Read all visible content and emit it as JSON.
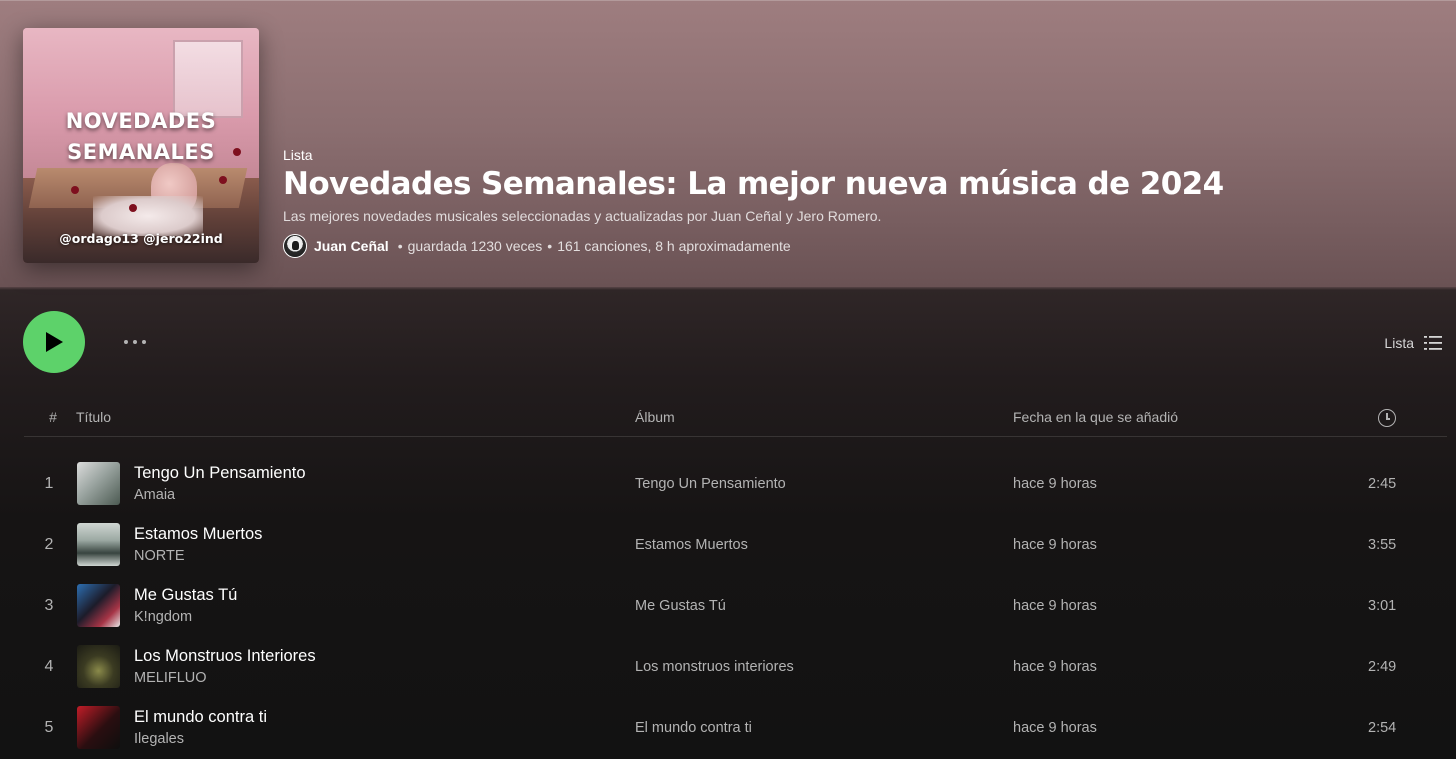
{
  "playlist": {
    "kind": "Lista",
    "title": "Novedades Semanales: La mejor nueva música de 2024",
    "description": "Las mejores novedades musicales seleccionadas y actualizadas por Juan Ceñal y Jero Romero.",
    "owner": "Juan Ceñal",
    "saves": "guardada 1230 veces",
    "stats": "161 canciones, 8 h aproximadamente",
    "separator": "•",
    "cover": {
      "line1": "NOVEDADES",
      "line2": "SEMANALES",
      "handles": "@ordago13 @jero22ind"
    }
  },
  "actions": {
    "play_icon": "play-icon",
    "more_icon": "more-icon",
    "view_label": "Lista",
    "view_icon": "list-icon"
  },
  "table": {
    "headers": {
      "number": "#",
      "title": "Título",
      "album": "Álbum",
      "date_added": "Fecha en la que se añadió",
      "duration_icon": "clock-icon"
    },
    "rows": [
      {
        "number": "1",
        "title": "Tengo Un Pensamiento",
        "artist": "Amaia",
        "album": "Tengo Un Pensamiento",
        "added": "hace 9 horas",
        "duration": "2:45"
      },
      {
        "number": "2",
        "title": "Estamos Muertos",
        "artist": "NORTE",
        "album": "Estamos Muertos",
        "added": "hace 9 horas",
        "duration": "3:55"
      },
      {
        "number": "3",
        "title": "Me Gustas Tú",
        "artist": "K!ngdom",
        "album": "Me Gustas Tú",
        "added": "hace 9 horas",
        "duration": "3:01"
      },
      {
        "number": "4",
        "title": "Los Monstruos Interiores",
        "artist": "MELIFLUO",
        "album": "Los monstruos interiores",
        "added": "hace 9 horas",
        "duration": "2:49"
      },
      {
        "number": "5",
        "title": "El mundo contra ti",
        "artist": "Ilegales",
        "album": "El mundo contra ti",
        "added": "hace 9 horas",
        "duration": "2:54"
      }
    ]
  },
  "colors": {
    "header": "#9e7d7f",
    "background": "#121212",
    "play_button": "#5dd26a",
    "text_primary": "#ffffff",
    "text_secondary": "#b3b3b3"
  }
}
